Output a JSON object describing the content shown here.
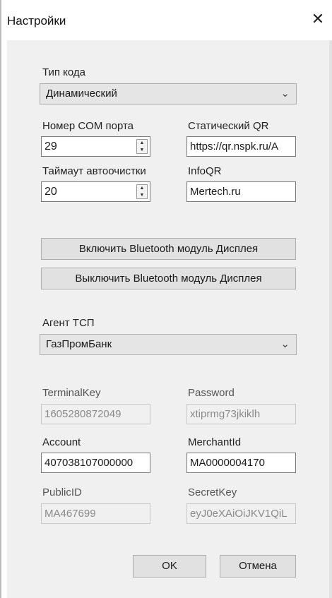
{
  "window": {
    "title": "Настройки"
  },
  "code_type": {
    "label": "Тип кода",
    "value": "Динамический"
  },
  "com_port": {
    "label": "Номер COM порта",
    "value": "29"
  },
  "static_qr": {
    "label": "Статический QR",
    "value": "https://qr.nspk.ru/A"
  },
  "autoclear": {
    "label": "Таймаут автоочистки",
    "value": "20"
  },
  "info_qr": {
    "label": "InfoQR",
    "value": "Mertech.ru"
  },
  "bluetooth": {
    "enable_label": "Включить Bluetooth модуль Дисплея",
    "disable_label": "Выключить Bluetooth модуль Дисплея"
  },
  "agent": {
    "label": "Агент ТСП",
    "value": "ГазПромБанк"
  },
  "terminal_key": {
    "label": "TerminalKey",
    "value": "1605280872049"
  },
  "password": {
    "label": "Password",
    "value": "xtiprmg73jkiklh"
  },
  "account": {
    "label": "Account",
    "value": "407038107000000"
  },
  "merchant_id": {
    "label": "MerchantId",
    "value": "MA0000004170"
  },
  "public_id": {
    "label": "PublicID",
    "value": "MA467699"
  },
  "secret_key": {
    "label": "SecretKey",
    "value": "eyJ0eXAiOiJKV1QiL"
  },
  "actions": {
    "ok_label": "OK",
    "cancel_label": "Отмена"
  },
  "icons": {
    "close": "close-icon",
    "combo_arrow": "chevron-down-icon",
    "spin_up": "spin-up-icon",
    "spin_down": "spin-down-icon"
  }
}
